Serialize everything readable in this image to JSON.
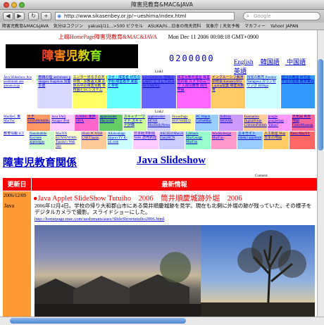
{
  "window": {
    "title": "障害児教育&MAC&JAVA"
  },
  "toolbar": {
    "back": "◀",
    "forward": "▶",
    "reload": "↻",
    "add": "+",
    "url": "http://www.sikasenbey.or.jp/~ueshima/index.html",
    "search_placeholder": "Google"
  },
  "bookmarks": [
    "障害児教育&MAC&JAVA",
    "気分はコクジン",
    "yakusiji11...>500 ピクセル",
    "ASUKA/hi...日本の飛天資料",
    "気象庁 | 天気予報",
    "マカフィー",
    "Yahoo! JAPAN"
  ],
  "header": {
    "site_title": "上嶋HomePage障害児教育&MAC&JAVA",
    "datetime": "Mon Dec 11 2006 00:08:18 GMT+0900",
    "logo_text": "障害児教育&MAC&JAVA",
    "counter": "0200000",
    "langs": [
      "English",
      "韓国語",
      "中国語",
      "英語"
    ]
  },
  "labels": {
    "link1": "Link1",
    "link2": "Link2",
    "contents": "Contents"
  },
  "big_links": {
    "left": "障害児教育関係",
    "right": "Java Slideshow"
  },
  "news_header": {
    "update": "更新日",
    "latest": "最新情報"
  },
  "news": {
    "date": "2006/12/09",
    "category": "Java",
    "title": "●Java Applet SlideShow Tutuiho　2006　筒井順慶城跡外堀　2006",
    "body": "2006年12月4日。学校の帰り大和郡山市にある筒井順慶城跡を見学。現在も北側に外堀の跡が残っていた。その様子をデジタルカメラで撮影。スライドショーにした。",
    "link": "http://homepage.mac.com/ueshimam/aues/SlideShowtutuiho2006.html"
  },
  "links_row1": [
    {
      "text": "Java Slideshow Ace ueshimam ues areues.or.jp",
      "bg": "#ffffff"
    },
    {
      "text": "教職の理 ueshimaes g ukagaw Kagokan 児童生徒",
      "bg": "#d9d9ff"
    },
    {
      "text": "エンター見る子の天 中田・宗教遺文庫 お休み中の障害児教 学校園とUCシステム",
      "bg": "#ffff66"
    },
    {
      "text": "ラボ・障害者 研究の学科 障害者学 家庭と学校",
      "bg": "#66ffff"
    },
    {
      "text": "LD STATION 地域の LAP27 どうしてSCA SKYMENU",
      "bg": "#6666ff"
    },
    {
      "text": "障害児教育連盟 障害児の会 カメラのムーブ 入院児教育 院内学級",
      "bg": "#ff66ff"
    },
    {
      "text": "インクルーシブ教育 研修会 Kanaori2003 Laptop授業 障害児教育",
      "bg": "#ffcc66"
    },
    {
      "text": "視覚の教育 Premier Naragawa カウンセリング IEDiga",
      "bg": "#ccffff"
    },
    {
      "text": "自分の教室 研究会 学習の関係 教育実践",
      "bg": "#3399ff"
    }
  ],
  "links_row2": [
    {
      "text": "MacBeC 東 MacTec",
      "bg": "#ffffff"
    },
    {
      "text": "ナチ KODAWARIKAN",
      "bg": "#ff9966"
    },
    {
      "text": "Java FAQ Aniapo iPod",
      "bg": "#ffccff"
    },
    {
      "text": "JUMBO 東野JAVA",
      "bg": "#ff66cc"
    },
    {
      "text": "appleinsider Macworld",
      "bg": "#66cc66"
    },
    {
      "text": "スキャナーワイド スキャナ評価",
      "bg": "#ccff99"
    },
    {
      "text": "appleinsider MOSE MacDailyNews",
      "bg": "#ccccff"
    },
    {
      "text": "PowerPage HOTWIRED",
      "bg": "#ffff99"
    },
    {
      "text": "PC Watch CnNetMac",
      "bg": "#99ccff"
    },
    {
      "text": "Softvan MOSXR",
      "bg": "#cc99ff"
    },
    {
      "text": "Fanmation DigitalFreak CrimsonPublish",
      "bg": "#ffcc99"
    },
    {
      "text": "google googlemap Yahoo!",
      "bg": "#ff99ff"
    },
    {
      "text": "天気図 世界地図 DantoMuseum",
      "bg": "#ff6699"
    }
  ],
  "links_row3": [
    {
      "text": "教育情報 ICT",
      "bg": "#ffffff"
    },
    {
      "text": "Nanobubble Keynote applesigns",
      "bg": "#ccffcc"
    },
    {
      "text": "MacNN KUMANOMS Tanaka's Web Site",
      "bg": "#ffffcc"
    },
    {
      "text": "iFixIt PCWEB CNETJapan",
      "bg": "#ffcc99"
    },
    {
      "text": "Allaboutapp ImprovTV K-ori.com",
      "bg": "#ccffff"
    },
    {
      "text": "日本経済新聞 NHK 読売新聞",
      "bg": "#ffccff"
    },
    {
      "text": "ASCII24 Mac24 DailyRCN",
      "bg": "#ccccff"
    },
    {
      "text": "Lifehack MacGarage MacFan",
      "bg": "#99ffcc"
    },
    {
      "text": "Worldsdesign MacFun",
      "bg": "#ff99cc"
    },
    {
      "text": "エキサイト mbdu2 appleism",
      "bg": "#99ccff"
    },
    {
      "text": "人工衛星 Map 日本の地図",
      "bg": "#ffcc66"
    },
    {
      "text": "Tatsu MacNY",
      "bg": "#ff6666"
    }
  ],
  "colors": {
    "accent_red": "#ff0000",
    "link_blue": "#0000cc",
    "date_cell": "#ff9933"
  }
}
